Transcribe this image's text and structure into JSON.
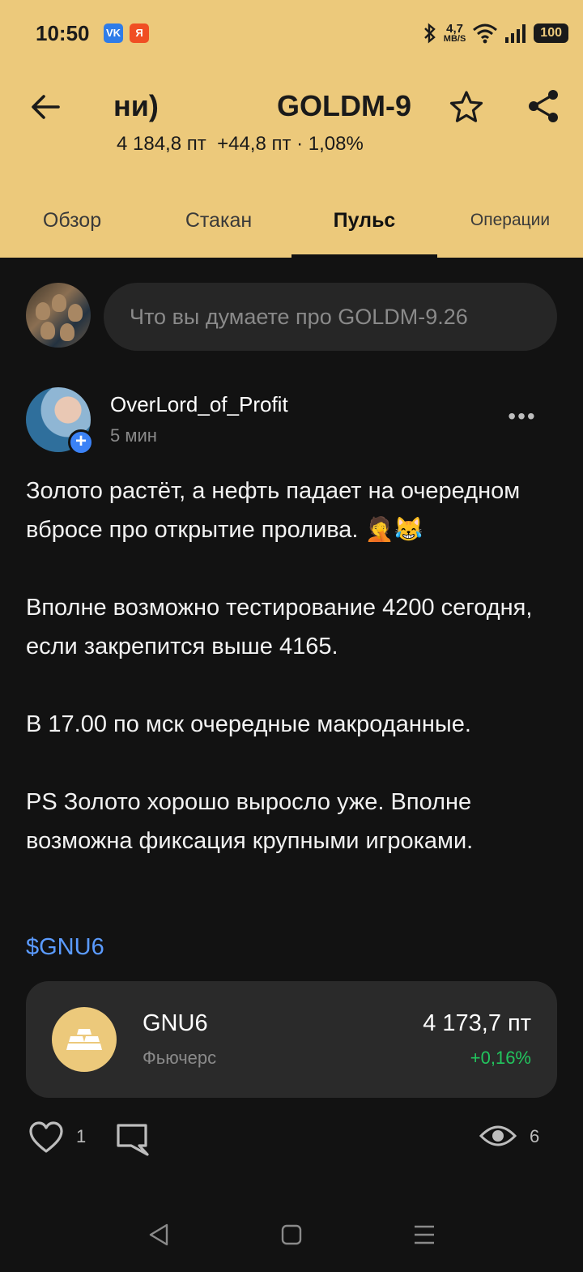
{
  "status_bar": {
    "time": "10:50",
    "badges": [
      "VK",
      "Я"
    ],
    "net_speed_value": "4,7",
    "net_speed_unit": "MB/S",
    "battery": "100"
  },
  "header": {
    "title_part1": "ни)",
    "title_part2": "GOLDM-9",
    "price": "4 184,8 пт",
    "change": "+44,8 пт · 1,08%"
  },
  "tabs": [
    {
      "label": "Обзор",
      "active": false
    },
    {
      "label": "Стакан",
      "active": false
    },
    {
      "label": "Пульс",
      "active": true
    },
    {
      "label": "Операции",
      "active": false
    }
  ],
  "compose": {
    "placeholder": "Что вы думаете про GOLDM-9.26"
  },
  "post": {
    "author": "OverLord_of_Profit",
    "time": "5 мин",
    "more": "•••",
    "paragraphs": [
      "Золото растёт, а нефть падает на очередном вбросе про открытие пролива. 🤦😹",
      "Вполне возможно тестирование 4200 сегодня, если закрепится выше 4165.",
      "В 17.00 по мск очередные макроданные.",
      "PS Золото хорошо выросло уже. Вполне возможна фиксация крупными игроками."
    ],
    "ticker_tag": "$GNU6",
    "instrument": {
      "name": "GNU6",
      "type": "Фьючерс",
      "price": "4 173,7 пт",
      "change": "+0,16%"
    },
    "likes": "1",
    "views": "6"
  },
  "colors": {
    "header_bg": "#ecc97b",
    "page_bg": "#121212",
    "link": "#5b9bff",
    "positive": "#22c55e"
  }
}
